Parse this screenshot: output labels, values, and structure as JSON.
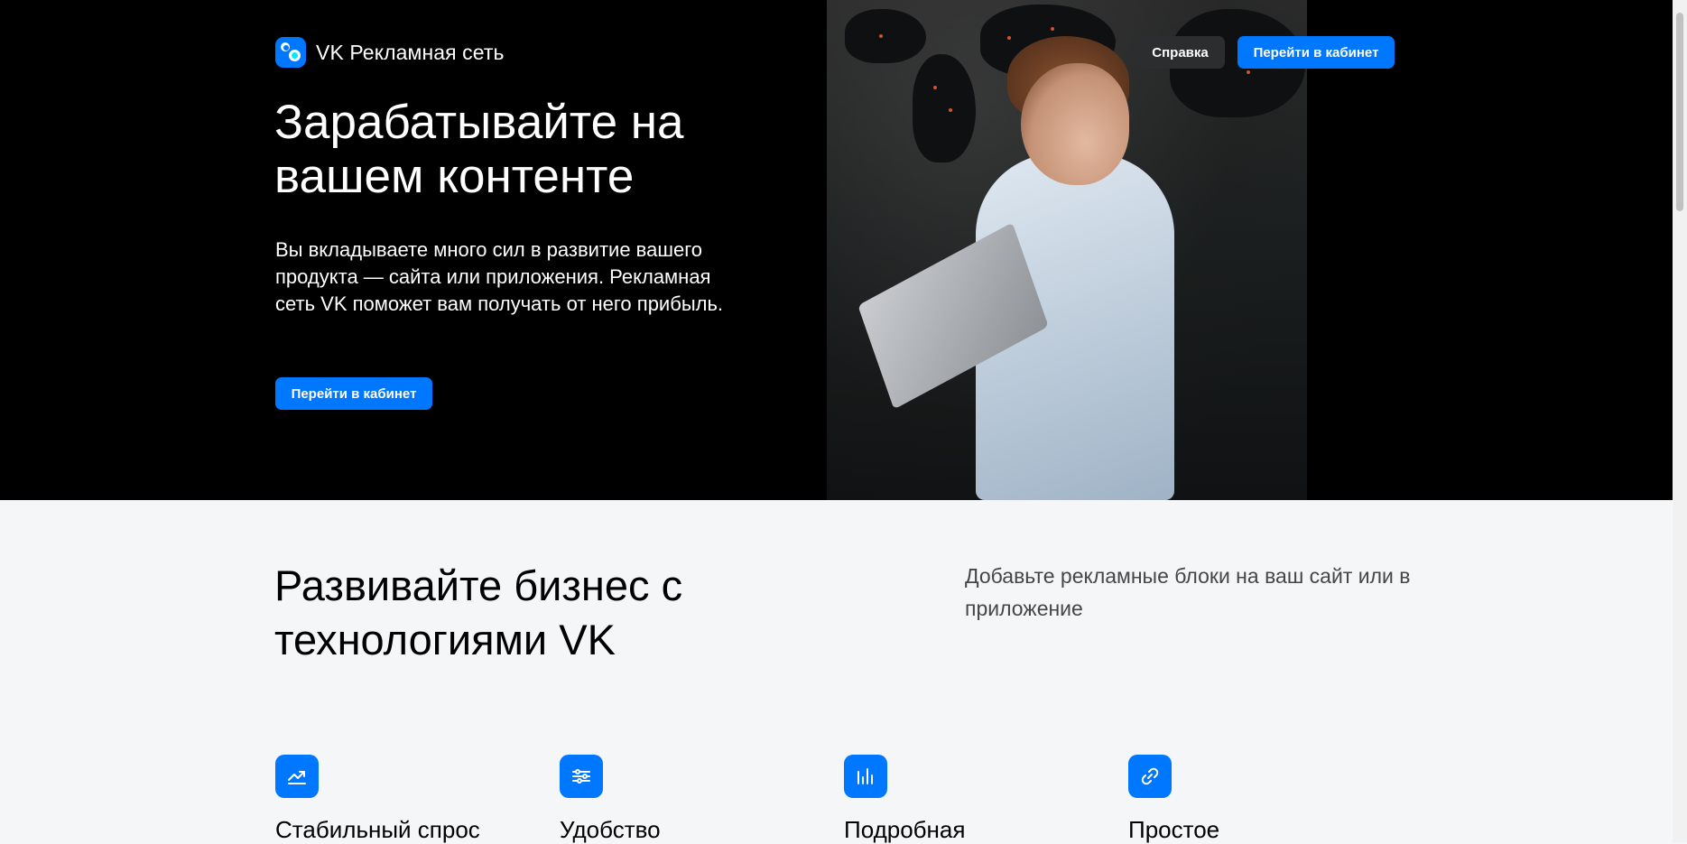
{
  "header": {
    "logo_text": "VK Рекламная сеть",
    "help_label": "Справка",
    "cabinet_label": "Перейти в кабинет"
  },
  "hero": {
    "title": "Зарабатывайте на вашем контенте",
    "subtitle": "Вы вкладываете много сил в развитие вашего продукта — сайта или приложения. Рекламная сеть VK поможет вам получать от него прибыль.",
    "cta_label": "Перейти в кабинет"
  },
  "business": {
    "title": "Развивайте бизнес с технологиями VK",
    "subtitle": "Добавьте рекламные блоки на ваш сайт или в приложение"
  },
  "features": [
    {
      "title": "Стабильный спрос",
      "icon": "trending-up-icon"
    },
    {
      "title": "Удобство",
      "icon": "sliders-icon"
    },
    {
      "title": "Подробная",
      "icon": "bar-chart-icon"
    },
    {
      "title": "Простое",
      "icon": "link-icon"
    }
  ],
  "colors": {
    "accent": "#0077ff",
    "hero_bg": "#000000",
    "secondary_button": "#2c2d2e",
    "page_bg": "#f5f6f8"
  }
}
